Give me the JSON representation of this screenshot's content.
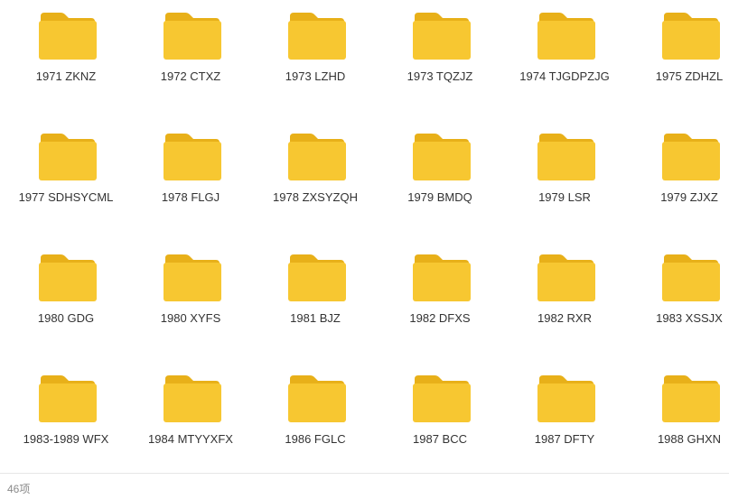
{
  "folder_icon": {
    "name": "folder-icon",
    "color_tab": "#E8B019",
    "color_body": "#F7C731"
  },
  "folders": [
    {
      "label": "1971 ZKNZ"
    },
    {
      "label": "1972 CTXZ"
    },
    {
      "label": "1973 LZHD"
    },
    {
      "label": "1973 TQZJZ"
    },
    {
      "label": "1974 TJGDPZJG"
    },
    {
      "label": "1975 ZDHZL"
    },
    {
      "label": "1977 SDHSYCML"
    },
    {
      "label": "1978 FLGJ"
    },
    {
      "label": "1978 ZXSYZQH"
    },
    {
      "label": "1979 BMDQ"
    },
    {
      "label": "1979 LSR"
    },
    {
      "label": "1979 ZJXZ"
    },
    {
      "label": "1980 GDG"
    },
    {
      "label": "1980 XYFS"
    },
    {
      "label": "1981 BJZ"
    },
    {
      "label": "1982 DFXS"
    },
    {
      "label": "1982 RXR"
    },
    {
      "label": "1983 XSSJX"
    },
    {
      "label": "1983-1989 WFX"
    },
    {
      "label": "1984 MTYYXFX"
    },
    {
      "label": "1986 FGLC"
    },
    {
      "label": "1987 BCC"
    },
    {
      "label": "1987 DFTY"
    },
    {
      "label": "1988 GHXN"
    }
  ],
  "status_bar": {
    "item_count": "46项"
  }
}
